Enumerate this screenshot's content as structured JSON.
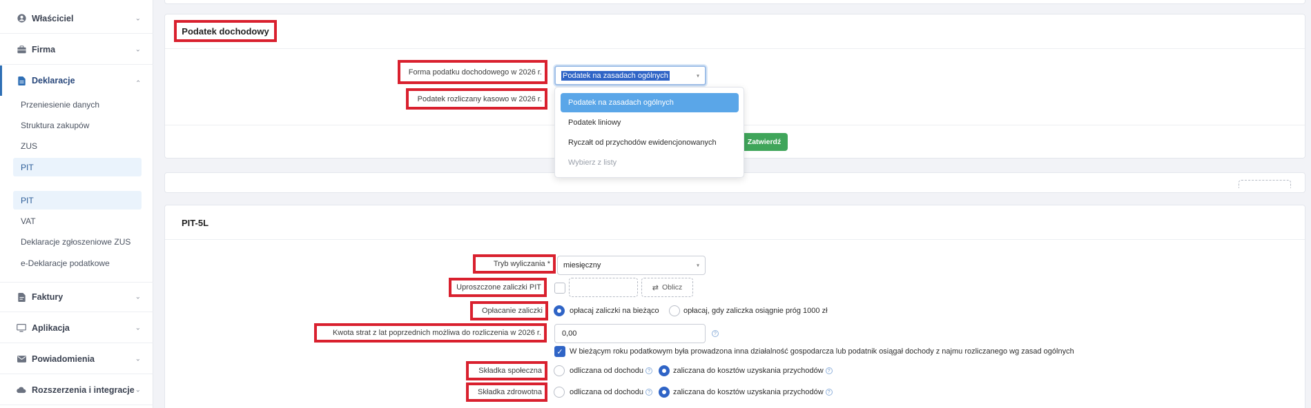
{
  "sidebar": {
    "sections": {
      "wlasciciel": "Właściciel",
      "firma": "Firma",
      "deklaracje": "Deklaracje",
      "faktury": "Faktury",
      "aplikacja": "Aplikacja",
      "powiadomienia": "Powiadomienia",
      "rozszerzenia": "Rozszerzenia i integracje"
    },
    "sub_items": {
      "przeniesienie": "Przeniesienie danych",
      "struktura": "Struktura zakupów",
      "zus": "ZUS",
      "pit1": "PIT",
      "pit2": "PIT",
      "vat": "VAT",
      "deklaracje_zus": "Deklaracje zgłoszeniowe ZUS",
      "edeklaracje": "e-Deklaracje podatkowe"
    }
  },
  "podatek_card": {
    "title": "Podatek dochodowy",
    "forma_label": "Forma podatku dochodowego w 2026 r.",
    "forma_value": "Podatek na zasadach ogólnych",
    "kasowo_label": "Podatek rozliczany kasowo w 2026 r.",
    "confirm_label": "Zatwierdź",
    "dropdown_options": [
      "Podatek na zasadach ogólnych",
      "Podatek liniowy",
      "Ryczałt od przychodów ewidencjonowanych",
      "Wybierz z listy"
    ]
  },
  "pit5l_card": {
    "title": "PIT-5L",
    "tryb_label": "Tryb wyliczania *",
    "tryb_value": "miesięczny",
    "uproszczone_label": "Uproszczone zaliczki PIT",
    "oblicz_label": "Oblicz",
    "oplacanie_label": "Opłacanie zaliczki",
    "oplacanie_opt1": "opłacaj zaliczki na bieżąco",
    "oplacanie_opt2": "opłacaj, gdy zaliczka osiągnie próg 1000 zł",
    "kwota_label": "Kwota strat z lat poprzednich możliwa do rozliczenia w 2026 r.",
    "kwota_value": "0,00",
    "dzialalnosc_text": "W bieżącym roku podatkowym była prowadzona inna działalność gospodarcza lub podatnik osiągał dochody z najmu rozliczanego wg zasad ogólnych",
    "spoleczna_label": "Składka społeczna",
    "zdrowotna_label": "Składka zdrowotna",
    "opt_od_dochodu": "odliczana od dochodu",
    "opt_do_kosztow": "zaliczana do kosztów uzyskania przychodów"
  },
  "colors": {
    "accent": "#2f64c6",
    "highlight_red": "#d9202e",
    "confirm_green": "#3fa55a",
    "sidebar_active": "#2f6fb5"
  },
  "icons": [
    "user-icon",
    "briefcase-icon",
    "document-icon",
    "invoice-icon",
    "monitor-icon",
    "envelope-icon",
    "cloud-icon",
    "chevron-down-icon",
    "chevron-up-icon",
    "shuffle-icon",
    "help-icon",
    "check-icon"
  ]
}
